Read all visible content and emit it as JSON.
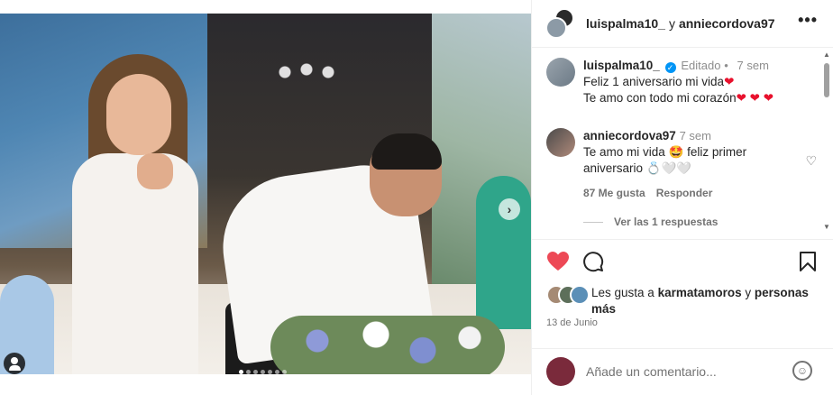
{
  "header": {
    "user1": "luispalma10_",
    "connector": "y",
    "user2": "anniecordova97",
    "more_label": "•••"
  },
  "comments": [
    {
      "user": "luispalma10_",
      "verified": true,
      "edited": "Editado",
      "separator": "•",
      "time": "7 sem",
      "line1": "Feliz 1 aniversario mi vida",
      "line1_emoji": "❤",
      "line2": "Te amo con todo mi corazón",
      "line2_emoji": "❤ ❤ ❤"
    },
    {
      "user": "anniecordova97",
      "time": "7 sem",
      "line1": "Te amo mi vida 🤩 feliz primer",
      "line2": "aniversario 💍🤍🤍",
      "likes": "87 Me gusta",
      "reply": "Responder",
      "view_replies": "Ver las 1 respuestas"
    }
  ],
  "likes": {
    "prefix": "Les gusta a",
    "user": "karmatamoros",
    "connector": "y",
    "others": "personas más"
  },
  "date": "13 de Junio",
  "comment_input": {
    "placeholder": "Añade un comentario..."
  },
  "icons": {
    "heart": "heart-icon",
    "comment": "comment-icon",
    "save": "bookmark-icon",
    "emoji": "emoji-icon",
    "next": "chevron-right-icon",
    "tag": "user-tag-icon"
  },
  "colors": {
    "like_red": "#ed4956",
    "verified_blue": "#0095f6"
  }
}
